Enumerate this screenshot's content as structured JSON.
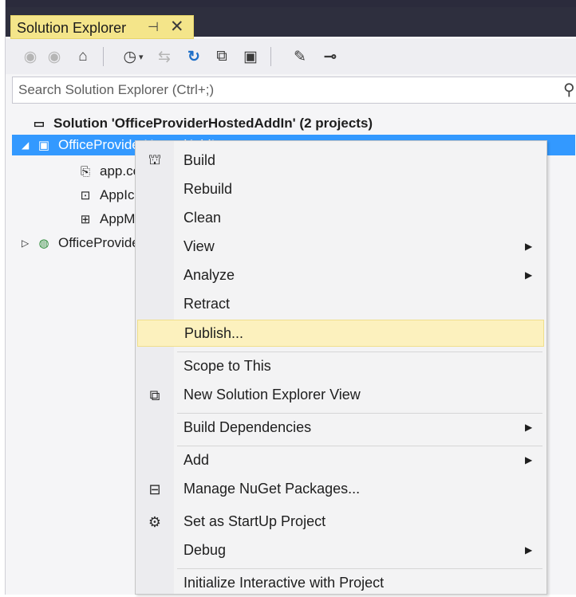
{
  "titlebar": {
    "title": "Solution Explorer",
    "pin_icon": "pin-icon",
    "close_icon": "close-icon"
  },
  "toolbar": {
    "icons": [
      "back-icon",
      "forward-icon",
      "home-icon",
      "history-icon",
      "sync-icon",
      "refresh-icon",
      "collapse-all-icon",
      "show-all-files-icon",
      "properties-icon",
      "preview-icon"
    ]
  },
  "search": {
    "placeholder": "Search Solution Explorer (Ctrl+;)"
  },
  "tree": {
    "solution": "Solution 'OfficeProviderHostedAddIn' (2 projects)",
    "project1": "OfficeProviderHostedAddIn",
    "item_app": "app.config",
    "item_appl1": "AppIcon",
    "item_appl2": "AppManifest",
    "project2": "OfficeProviderHostedAddInWeb"
  },
  "menu": {
    "build": "Build",
    "rebuild": "Rebuild",
    "clean": "Clean",
    "view": "View",
    "analyze": "Analyze",
    "retract": "Retract",
    "publish": "Publish...",
    "scope": "Scope to This",
    "new_view": "New Solution Explorer View",
    "build_deps": "Build Dependencies",
    "add": "Add",
    "nuget": "Manage NuGet Packages...",
    "startup": "Set as StartUp Project",
    "debug": "Debug",
    "interactive": "Initialize Interactive with Project"
  },
  "colors": {
    "title_bg": "#f4e58a",
    "selection": "#3399ff",
    "highlight": "#fcf1be"
  }
}
